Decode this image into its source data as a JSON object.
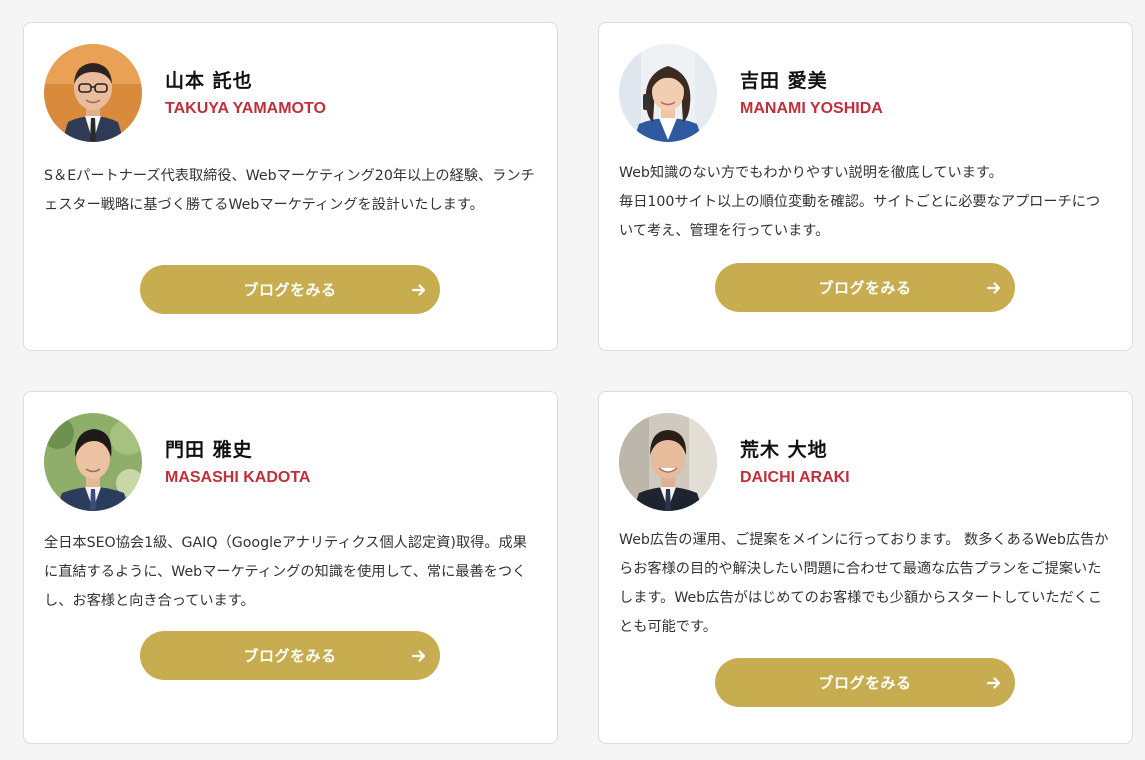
{
  "members": [
    {
      "name_jp": "山本 託也",
      "name_en": "TAKUYA YAMAMOTO",
      "description": "S＆Eパートナーズ代表取締役、Webマーケティング20年以上の経験、ランチェスター戦略に基づく勝てるWebマーケティングを設計いたします。",
      "button_label": "ブログをみる",
      "avatar_icon": "person-photo-icon"
    },
    {
      "name_jp": "吉田 愛美",
      "name_en": "MANAMI YOSHIDA",
      "description": "Web知識のない方でもわかりやすい説明を徹底しています。\n毎日100サイト以上の順位変動を確認。サイトごとに必要なアプローチについて考え、管理を行っています。",
      "button_label": "ブログをみる",
      "avatar_icon": "person-photo-icon"
    },
    {
      "name_jp": "門田 雅史",
      "name_en": "MASASHI KADOTA",
      "description": "全日本SEO協会1級、GAIQ（Googleアナリティクス個人認定資)取得。成果に直結するように、Webマーケティングの知識を使用して、常に最善をつくし、お客様と向き合っています。",
      "button_label": "ブログをみる",
      "avatar_icon": "person-photo-icon"
    },
    {
      "name_jp": "荒木 大地",
      "name_en": "DAICHI ARAKI",
      "description": "Web広告の運用、ご提案をメインに行っております。 数多くあるWeb広告からお客様の目的や解決したい問題に合わせて最適な広告プランをご提案いたします。Web広告がはじめてのお客様でも少額からスタートしていただくことも可能です。",
      "button_label": "ブログをみる",
      "avatar_icon": "person-photo-icon"
    }
  ],
  "button_arrow_icon": "arrow-right-icon",
  "colors": {
    "accent_gold": "#c7ad50",
    "name_en_red": "#c0303a",
    "background": "#f5f5f5",
    "card_background": "#ffffff"
  }
}
